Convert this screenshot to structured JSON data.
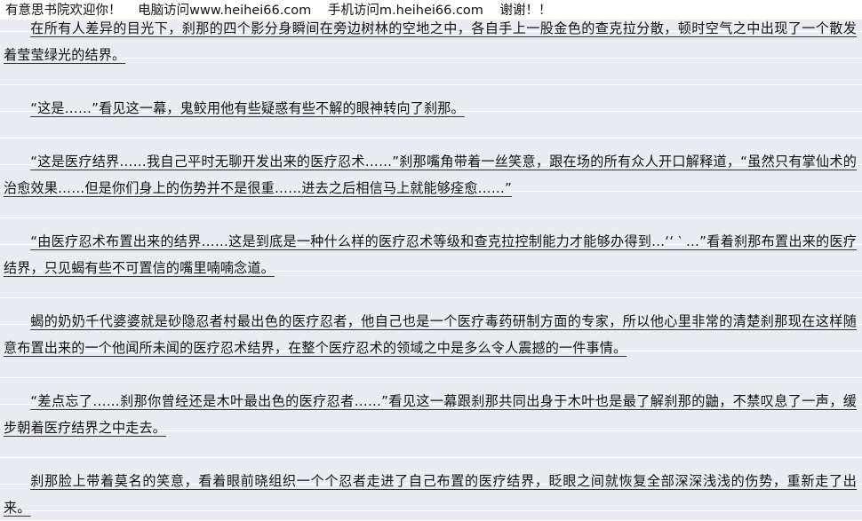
{
  "banner": {
    "welcome": "有意思书院欢迎你！",
    "pc": "电脑访问www.heihei66.com",
    "mobile": "手机访问m.heihei66.com",
    "thanks": "谢谢！！"
  },
  "paragraphs": [
    "在所有人差异的目光下，刹那的四个影分身瞬间在旁边树林的空地之中，各自手上一股金色的查克拉分散，顿时空气之中出现了一个散发着莹莹绿光的结界。",
    "“这是……”看见这一幕，鬼鲛用他有些疑惑有些不解的眼神转向了刹那。",
    "“这是医疗结界……我自己平时无聊开发出来的医疗忍术……”刹那嘴角带着一丝笑意，跟在场的所有众人开口解释道，“虽然只有掌仙术的治愈效果……但是你们身上的伤势并不是很重……进去之后相信马上就能够痊愈……”",
    "“由医疗忍术布置出来的结界……这是到底是一种什么样的医疗忍术等级和查克拉控制能力才能够办得到…‘‘ ‵ …”看着刹那布置出来的医疗结界，只见蝎有些不可置信的嘴里喃喃念道。",
    "蝎的奶奶千代婆婆就是砂隐忍者村最出色的医疗忍者，他自己也是一个医疗毒药研制方面的专家，所以他心里非常的清楚刹那现在这样随意布置出来的一个他闻所未闻的医疗忍术结界，在整个医疗忍术的领域之中是多么令人震撼的一件事情。",
    "“差点忘了……刹那你曾经还是木叶最出色的医疗忍者……”看见这一幕跟刹那共同出身于木叶也是最了解刹那的鼬，不禁叹息了一声，缓步朝着医疗结界之中走去。",
    "刹那脸上带着莫名的笑意，看着眼前晓组织一个个忍者走进了自己布置的医疗结界，眨眼之间就恢复全部深深浅浅的伤势，重新走了出来。"
  ]
}
